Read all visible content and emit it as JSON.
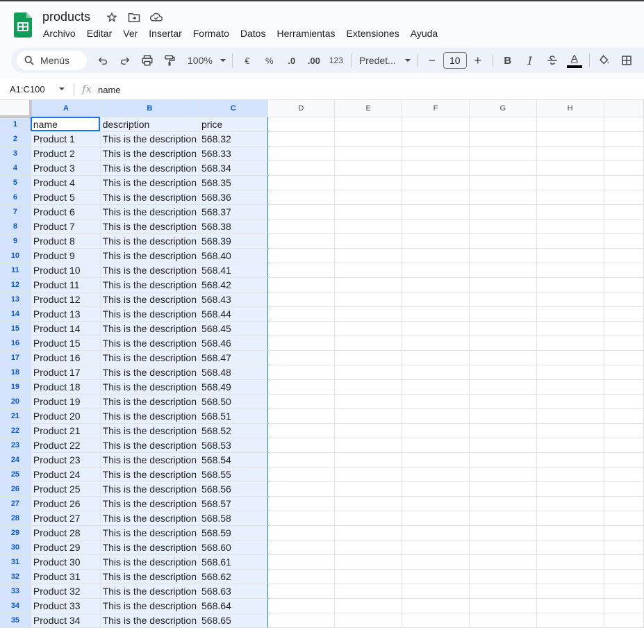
{
  "app": {
    "title": "products",
    "brand_color": "#0f9d58"
  },
  "menu": [
    "Archivo",
    "Editar",
    "Ver",
    "Insertar",
    "Formato",
    "Datos",
    "Herramientas",
    "Extensiones",
    "Ayuda"
  ],
  "toolbar": {
    "search_label": "Menús",
    "zoom": "100%",
    "currency": "€",
    "percent": "%",
    "dec_decrease": ".0",
    "dec_increase": ".00",
    "number_format": "123",
    "font_name": "Predet...",
    "font_size": "10",
    "minus": "−",
    "plus": "+",
    "bold": "B",
    "italic": "I",
    "text_color_label": "A"
  },
  "formula_bar": {
    "name_box": "A1:C100",
    "fx": "fx",
    "value": "name"
  },
  "columns": [
    "A",
    "B",
    "C",
    "D",
    "E",
    "F",
    "G",
    "H"
  ],
  "rows": [
    {
      "n": "1",
      "a": "name",
      "b": "description",
      "c": "price"
    },
    {
      "n": "2",
      "a": "Product 1",
      "b": "This is the description",
      "c": "568.32"
    },
    {
      "n": "3",
      "a": "Product 2",
      "b": "This is the description",
      "c": "568.33"
    },
    {
      "n": "4",
      "a": "Product 3",
      "b": "This is the description",
      "c": "568.34"
    },
    {
      "n": "5",
      "a": "Product 4",
      "b": "This is the description",
      "c": "568.35"
    },
    {
      "n": "6",
      "a": "Product 5",
      "b": "This is the description",
      "c": "568.36"
    },
    {
      "n": "7",
      "a": "Product 6",
      "b": "This is the description",
      "c": "568.37"
    },
    {
      "n": "8",
      "a": "Product 7",
      "b": "This is the description",
      "c": "568.38"
    },
    {
      "n": "9",
      "a": "Product 8",
      "b": "This is the description",
      "c": "568.39"
    },
    {
      "n": "10",
      "a": "Product 9",
      "b": "This is the description",
      "c": "568.40"
    },
    {
      "n": "11",
      "a": "Product 10",
      "b": "This is the description",
      "c": "568.41"
    },
    {
      "n": "12",
      "a": "Product 11",
      "b": "This is the description",
      "c": "568.42"
    },
    {
      "n": "13",
      "a": "Product 12",
      "b": "This is the description",
      "c": "568.43"
    },
    {
      "n": "14",
      "a": "Product 13",
      "b": "This is the description",
      "c": "568.44"
    },
    {
      "n": "15",
      "a": "Product 14",
      "b": "This is the description",
      "c": "568.45"
    },
    {
      "n": "16",
      "a": "Product 15",
      "b": "This is the description",
      "c": "568.46"
    },
    {
      "n": "17",
      "a": "Product 16",
      "b": "This is the description",
      "c": "568.47"
    },
    {
      "n": "18",
      "a": "Product 17",
      "b": "This is the description",
      "c": "568.48"
    },
    {
      "n": "19",
      "a": "Product 18",
      "b": "This is the description",
      "c": "568.49"
    },
    {
      "n": "20",
      "a": "Product 19",
      "b": "This is the description",
      "c": "568.50"
    },
    {
      "n": "21",
      "a": "Product 20",
      "b": "This is the description",
      "c": "568.51"
    },
    {
      "n": "22",
      "a": "Product 21",
      "b": "This is the description",
      "c": "568.52"
    },
    {
      "n": "23",
      "a": "Product 22",
      "b": "This is the description",
      "c": "568.53"
    },
    {
      "n": "24",
      "a": "Product 23",
      "b": "This is the description",
      "c": "568.54"
    },
    {
      "n": "25",
      "a": "Product 24",
      "b": "This is the description",
      "c": "568.55"
    },
    {
      "n": "26",
      "a": "Product 25",
      "b": "This is the description",
      "c": "568.56"
    },
    {
      "n": "27",
      "a": "Product 26",
      "b": "This is the description",
      "c": "568.57"
    },
    {
      "n": "28",
      "a": "Product 27",
      "b": "This is the description",
      "c": "568.58"
    },
    {
      "n": "29",
      "a": "Product 28",
      "b": "This is the description",
      "c": "568.59"
    },
    {
      "n": "30",
      "a": "Product 29",
      "b": "This is the description",
      "c": "568.60"
    },
    {
      "n": "31",
      "a": "Product 30",
      "b": "This is the description",
      "c": "568.61"
    },
    {
      "n": "32",
      "a": "Product 31",
      "b": "This is the description",
      "c": "568.62"
    },
    {
      "n": "33",
      "a": "Product 32",
      "b": "This is the description",
      "c": "568.63"
    },
    {
      "n": "34",
      "a": "Product 33",
      "b": "This is the description",
      "c": "568.64"
    },
    {
      "n": "35",
      "a": "Product 34",
      "b": "This is the description",
      "c": "568.65"
    }
  ]
}
